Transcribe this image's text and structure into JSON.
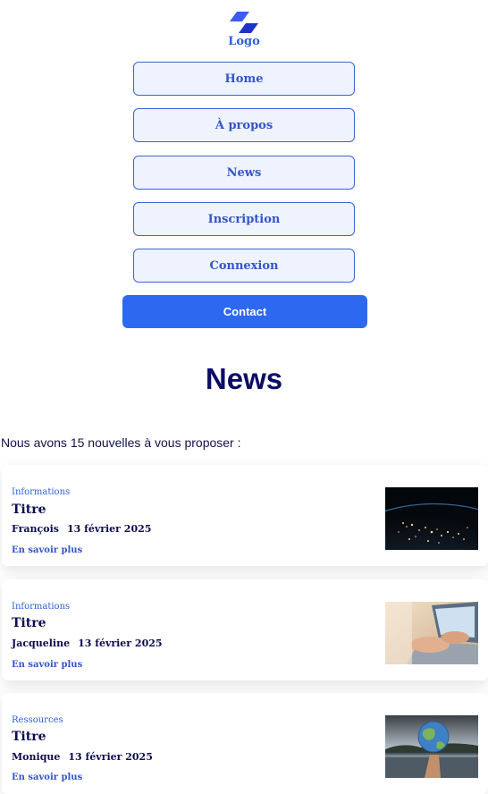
{
  "logo": {
    "label": "Logo"
  },
  "nav": {
    "items": [
      "Home",
      "À propos",
      "News",
      "Inscription",
      "Connexion"
    ],
    "contact": "Contact"
  },
  "page": {
    "title": "News",
    "intro": "Nous avons 15 nouvelles à vous proposer :"
  },
  "articles": [
    {
      "category": "Informations",
      "title": "Titre",
      "author": "François",
      "date": "13 février 2025",
      "link": "En savoir plus",
      "image": "earth-at-night"
    },
    {
      "category": "Informations",
      "title": "Titre",
      "author": "Jacqueline",
      "date": "13 février 2025",
      "link": "En savoir plus",
      "image": "hands-on-laptop"
    },
    {
      "category": "Ressources",
      "title": "Titre",
      "author": "Monique",
      "date": "13 février 2025",
      "link": "En savoir plus",
      "image": "globe-over-lake"
    }
  ],
  "colors": {
    "accent": "#2d68f0",
    "navy": "#0c0c66",
    "link": "#3455c8"
  }
}
